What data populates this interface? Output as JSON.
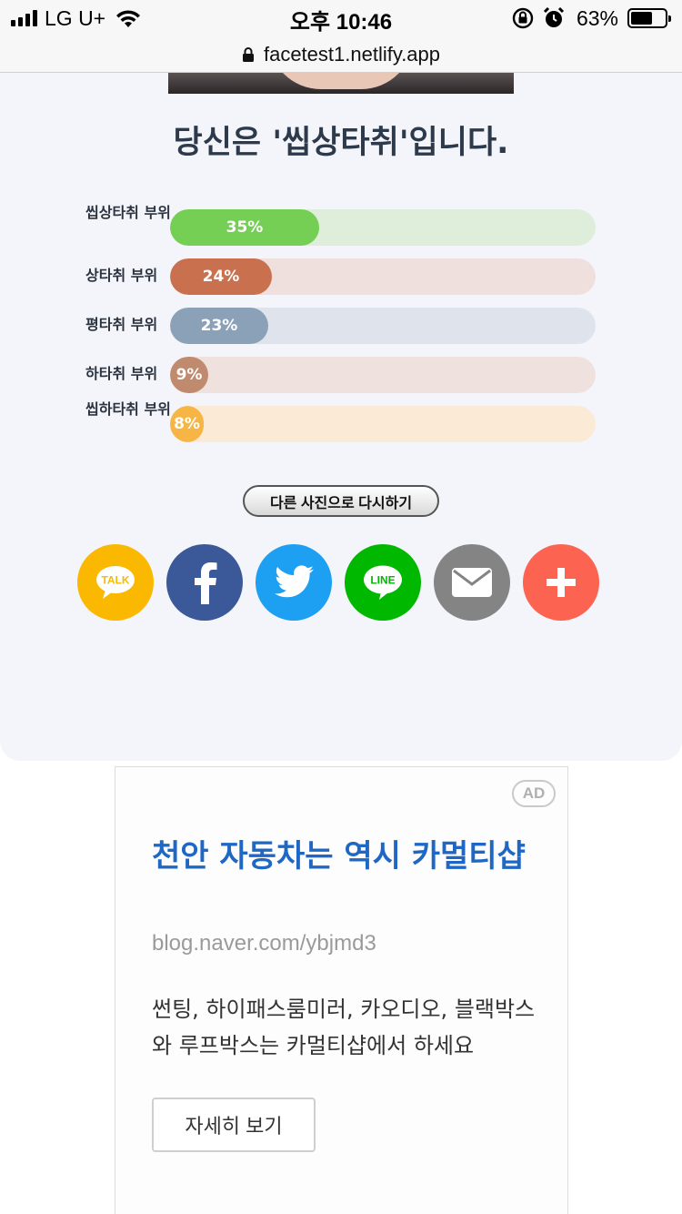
{
  "status_bar": {
    "carrier": "LG U+",
    "time": "오후 10:46",
    "battery_percent": "63%",
    "battery_level": 0.63
  },
  "browser": {
    "url": "facetest1.netlify.app"
  },
  "result": {
    "title": "당신은 '씹상타취'입니다.",
    "bars": [
      {
        "label": "씹상타취 부위",
        "value": 35,
        "value_text": "35%",
        "color": "#75cf55",
        "track_color": "#deeedb"
      },
      {
        "label": "상타취 부위",
        "value": 24,
        "value_text": "24%",
        "color": "#c9704f",
        "track_color": "#efdfdd"
      },
      {
        "label": "평타취 부위",
        "value": 23,
        "value_text": "23%",
        "color": "#8aa1b8",
        "track_color": "#dfe3ec"
      },
      {
        "label": "하타취 부위",
        "value": 9,
        "value_text": "9%",
        "color": "#c08a6e",
        "track_color": "#efe1dd"
      },
      {
        "label": "씹하타취 부위",
        "value": 8,
        "value_text": "8%",
        "color": "#f6b544",
        "track_color": "#fbebd6"
      }
    ],
    "retry_label": "다른 사진으로 다시하기"
  },
  "share": [
    {
      "name": "kakaotalk",
      "icon": "kakaotalk-icon",
      "color": "#fab900",
      "glyph_text": "TALK"
    },
    {
      "name": "facebook",
      "icon": "facebook-icon",
      "color": "#3b5898"
    },
    {
      "name": "twitter",
      "icon": "twitter-icon",
      "color": "#1da0f2"
    },
    {
      "name": "line",
      "icon": "line-icon",
      "color": "#00b800",
      "glyph_text": "LINE"
    },
    {
      "name": "email",
      "icon": "mail-icon",
      "color": "#848484"
    },
    {
      "name": "more",
      "icon": "plus-icon",
      "color": "#fc6350"
    }
  ],
  "ad": {
    "badge": "AD",
    "title": "천안 자동차는 역시 카멀티샵",
    "url": "blog.naver.com/ybjmd3",
    "description": "썬팅, 하이패스룸미러, 카오디오, 블랙박스와 루프박스는 카멀티샵에서 하세요",
    "button_label": "자세히 보기"
  }
}
